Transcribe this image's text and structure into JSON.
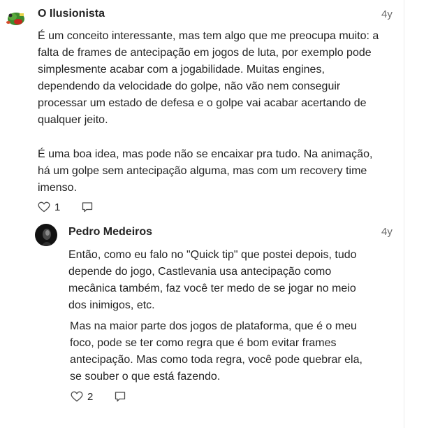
{
  "comments": [
    {
      "author": "O Ilusionista",
      "age": "4y",
      "avatar_icon": "green-red-creature-avatar",
      "paragraphs": [
        "É um conceito interessante, mas tem algo que me preocupa muito: a falta de frames de antecipação em jogos de luta, por exemplo pode simplesmente acabar com a jogabilidade. Muitas engines, dependendo da velocidade do golpe, não vão nem conseguir processar um estado de defesa e o golpe vai acabar acertando de qualquer jeito.",
        "É uma boa idea, mas pode não se encaixar pra tudo. Na animação, há um golpe sem antecipação alguma, mas com um recovery time imenso."
      ],
      "likes": "1",
      "like_icon": "heart-outline-icon",
      "reply_icon": "speech-bubble-icon"
    },
    {
      "author": "Pedro Medeiros",
      "age": "4y",
      "avatar_icon": "dark-portrait-avatar",
      "paragraphs": [
        "Então, como eu falo no \"Quick tip\" que postei depois, tudo depende do jogo, Castlevania usa antecipação como mecânica também, faz você ter medo de se jogar no meio dos inimigos, etc.",
        "Mas na maior parte dos jogos de plataforma, que é o meu foco, pode se ter como regra que é bom evitar frames antecipação. Mas como toda regra, você pode quebrar ela, se souber o que está fazendo."
      ],
      "likes": "2",
      "like_icon": "heart-outline-icon",
      "reply_icon": "speech-bubble-icon"
    }
  ],
  "colors": {
    "text": "#242424",
    "muted": "#6b6b6b",
    "rule": "#ececec"
  }
}
